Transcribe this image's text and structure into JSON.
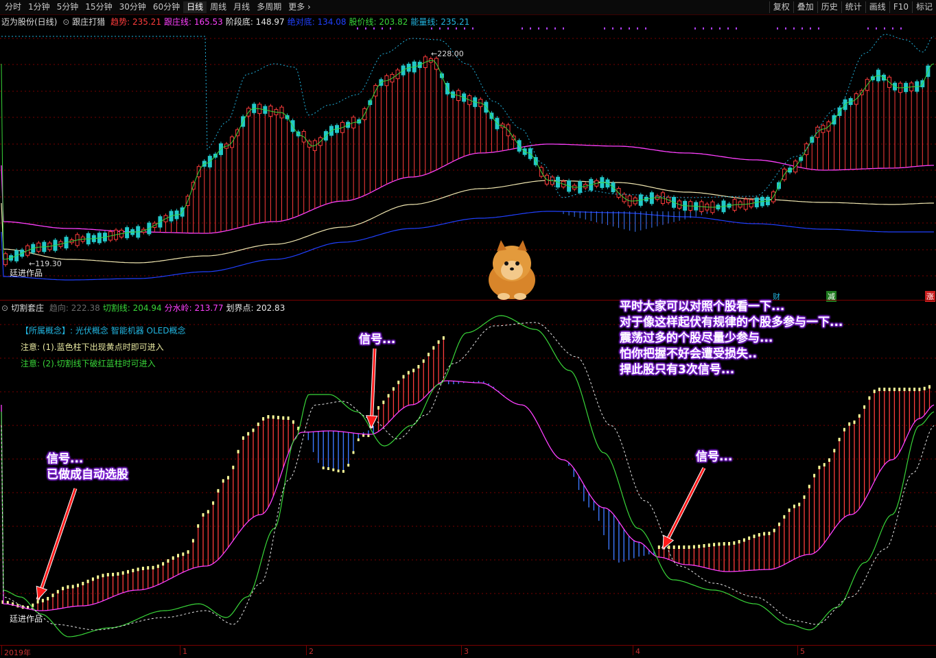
{
  "toolbar": {
    "periods": [
      "分时",
      "1分钟",
      "5分钟",
      "15分钟",
      "30分钟",
      "60分钟",
      "日线",
      "周线",
      "月线",
      "多周期",
      "更多"
    ],
    "active": "日线",
    "more_arrow": "›",
    "right": [
      "复权",
      "叠加",
      "历史",
      "统计",
      "画线",
      "F10",
      "标记"
    ]
  },
  "main_header": {
    "stock": "迈为股份(日线)",
    "indicator": "跟庄打猎",
    "items": [
      {
        "label": "趋势: 235.21",
        "color": "#ff3c3c"
      },
      {
        "label": "跟庄线: 165.53",
        "color": "#ff40ff"
      },
      {
        "label": "阶段底: 148.97",
        "color": "#e8e8e8"
      },
      {
        "label": "绝对底: 134.08",
        "color": "#2040ff"
      },
      {
        "label": "股价线: 203.82",
        "color": "#39d639"
      },
      {
        "label": "能量线: 235.21",
        "color": "#22b5e0"
      }
    ]
  },
  "main_annotations": {
    "high": "228.00",
    "low": "119.30",
    "author": "廷进作品"
  },
  "main_markers": {
    "cai": "财",
    "jian": "减",
    "zhang": "涨"
  },
  "sub_header": {
    "indicator": "切割套庄",
    "items": [
      {
        "label": "趋向: 222.38",
        "color": "#6a6a6a"
      },
      {
        "label": "切割线: 204.94",
        "color": "#39d639"
      },
      {
        "label": "分水岭: 213.77",
        "color": "#ff40ff"
      },
      {
        "label": "划界点: 202.83",
        "color": "#e8e8e8"
      }
    ]
  },
  "concept": {
    "label": "【所属概念】:",
    "value": "光伏概念 智能机器 OLED概念"
  },
  "notes": {
    "note1": "注意: (1).蓝色柱下出现黄点时即可进入",
    "note2": "注意: (2).切割线下破红蓝柱时可进入"
  },
  "callouts": {
    "signal1_line1": "信号...",
    "signal1_line2": "已做成自动选股",
    "signal2": "信号...",
    "signal3": "信号...",
    "advice": [
      "平时大家可以对照个股看一下...",
      "对于像这样起伏有规律的个股多参与一下...",
      "震荡过多的个股尽量少参与...",
      "怕你把握不好会遭受损失..",
      "捍此股只有3次信号..."
    ]
  },
  "sub_author": "廷进作品",
  "xaxis": {
    "labels": [
      "2019年",
      "1",
      "2",
      "3",
      "4",
      "5"
    ]
  },
  "colors": {
    "up": "#ff3c3c",
    "down": "#22c8c8",
    "bar_blue": "#3c78ff",
    "yellow": "#ffff99",
    "pink": "#ff40ff",
    "green": "#39d639",
    "grid": "#7a0000"
  }
}
